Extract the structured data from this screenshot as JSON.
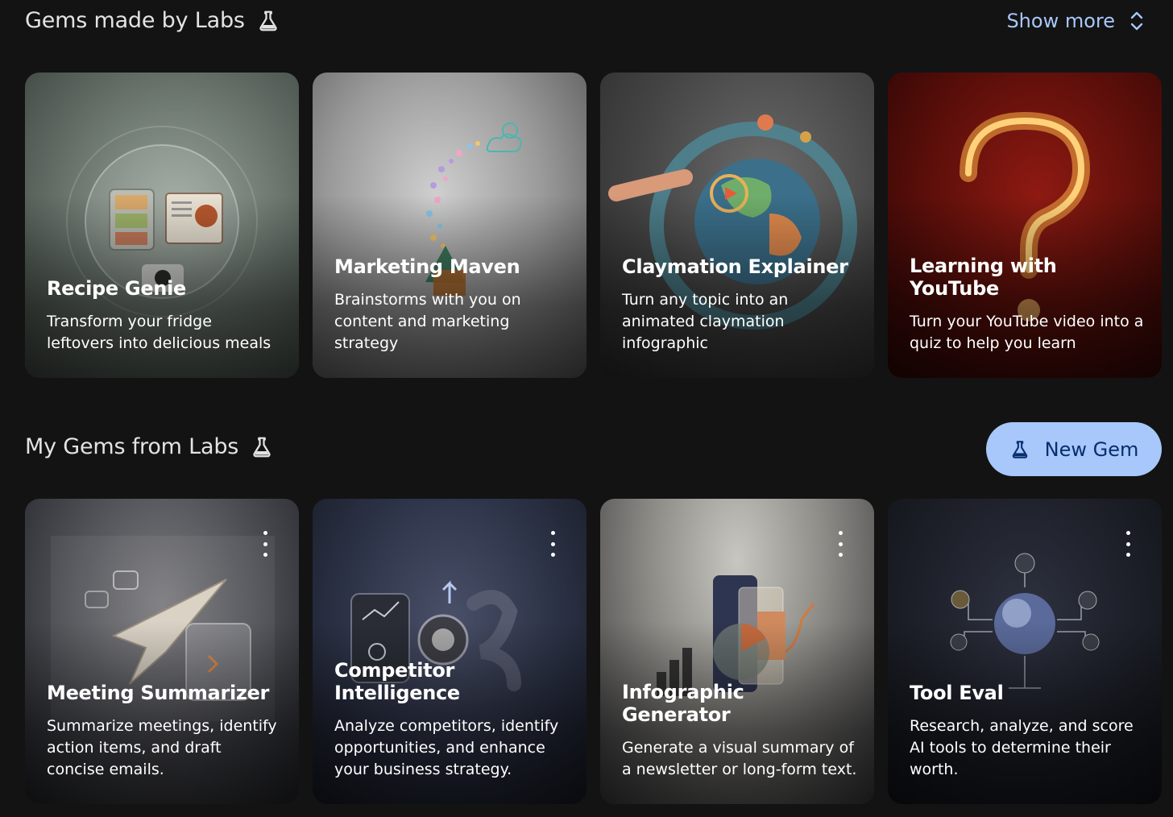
{
  "labs_section": {
    "title": "Gems made by Labs",
    "show_more": "Show more",
    "cards": [
      {
        "name": "Recipe Genie",
        "desc": "Transform your fridge leftovers into delicious meals"
      },
      {
        "name": "Marketing Maven",
        "desc": "Brainstorms with you on content and marketing strategy"
      },
      {
        "name": "Claymation Explainer",
        "desc": "Turn any topic into an animated claymation infographic"
      },
      {
        "name": "Learning with YouTube",
        "desc": "Turn your YouTube video into a quiz to help you learn"
      }
    ]
  },
  "my_section": {
    "title": "My Gems from Labs",
    "new_gem": "New Gem",
    "cards": [
      {
        "name": "Meeting Summarizer",
        "desc": "Summarize meetings, identify action items, and draft concise emails."
      },
      {
        "name": "Competitor Intelligence",
        "desc": "Analyze competitors, identify opportunities, and enhance your business strategy."
      },
      {
        "name": "Infographic Generator",
        "desc": "Generate a visual summary of a newsletter or long-form text."
      },
      {
        "name": "Tool Eval",
        "desc": "Research, analyze, and score AI tools to determine their worth."
      }
    ]
  },
  "icons": {
    "labs": "flask-icon",
    "show_more": "unfold-more-icon",
    "card_menu": "more-vert-icon"
  },
  "colors": {
    "background": "#131313",
    "accent": "#a8c7fa",
    "accent_text": "#062e6f"
  }
}
